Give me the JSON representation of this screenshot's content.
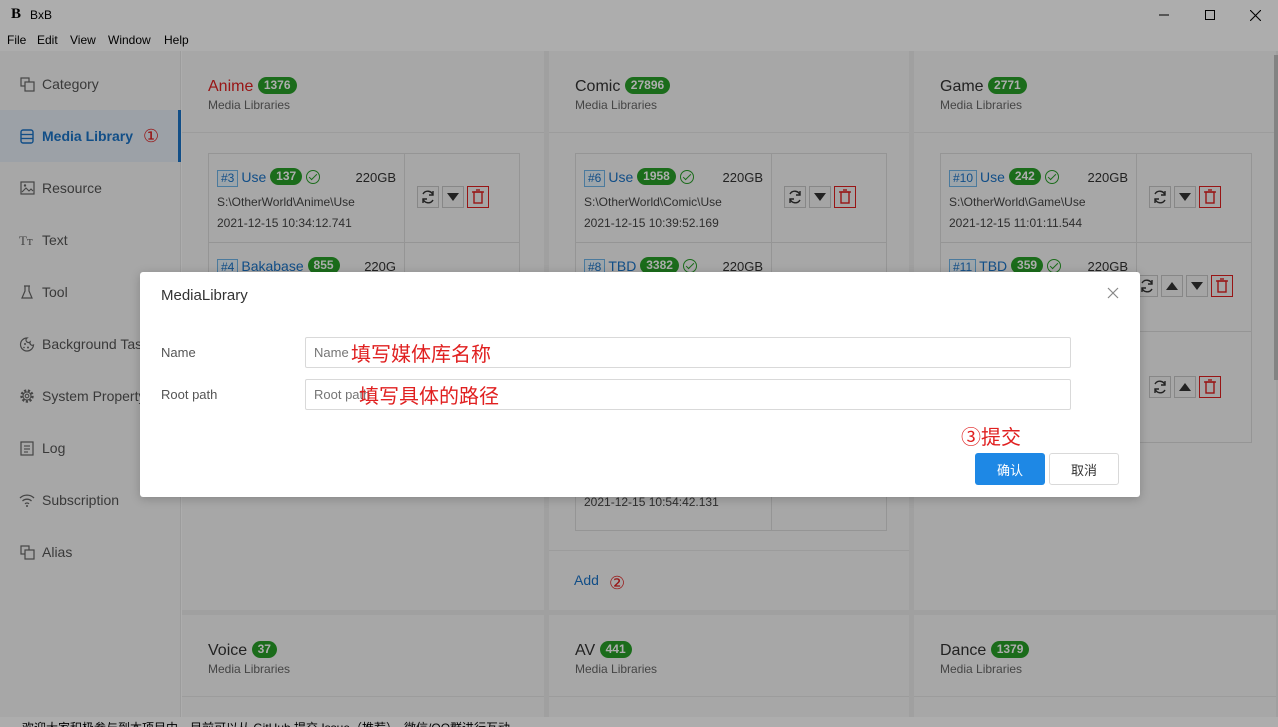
{
  "window": {
    "logo": "B",
    "title": "BxB"
  },
  "menu": [
    "File",
    "Edit",
    "View",
    "Window",
    "Help"
  ],
  "sidebar": {
    "items": [
      {
        "label": "Category",
        "icon": "category-icon"
      },
      {
        "label": "Media Library",
        "icon": "database-icon",
        "active": true,
        "annotation": "①"
      },
      {
        "label": "Resource",
        "icon": "image-icon"
      },
      {
        "label": "Text",
        "icon": "text-icon"
      },
      {
        "label": "Tool",
        "icon": "tool-icon"
      },
      {
        "label": "Background Tas",
        "icon": "cookie-icon"
      },
      {
        "label": "System Property",
        "icon": "gear-icon"
      },
      {
        "label": "Log",
        "icon": "log-icon"
      },
      {
        "label": "Subscription",
        "icon": "wifi-icon"
      },
      {
        "label": "Alias",
        "icon": "alias-icon"
      }
    ]
  },
  "panels": {
    "anime": {
      "title": "Anime",
      "count": "1376",
      "subtitle": "Media Libraries",
      "libs": [
        {
          "id": "#3",
          "name": "Use",
          "count": "137",
          "size": "220GB",
          "path": "S:\\OtherWorld\\Anime\\Use",
          "date": "2021-12-15 10:34:12.741"
        },
        {
          "id": "#4",
          "name": "Bakabase",
          "count": "855",
          "size": "220G"
        }
      ]
    },
    "comic": {
      "title": "Comic",
      "count": "27896",
      "subtitle": "Media Libraries",
      "libs": [
        {
          "id": "#6",
          "name": "Use",
          "count": "1958",
          "size": "220GB",
          "path": "S:\\OtherWorld\\Comic\\Use",
          "date": "2021-12-15 10:39:52.169"
        },
        {
          "id": "#8",
          "name": "TBD",
          "count": "3382",
          "size": "220GB"
        }
      ],
      "last_date": "2021-12-15 10:54:42.131",
      "add": "Add",
      "add_annotation": "②"
    },
    "game": {
      "title": "Game",
      "count": "2771",
      "subtitle": "Media Libraries",
      "libs": [
        {
          "id": "#10",
          "name": "Use",
          "count": "242",
          "size": "220GB",
          "path": "S:\\OtherWorld\\Game\\Use",
          "date": "2021-12-15 11:01:11.544"
        },
        {
          "id": "#11",
          "name": "TBD",
          "count": "359",
          "size": "220GB"
        }
      ]
    },
    "voice": {
      "title": "Voice",
      "count": "37",
      "subtitle": "Media Libraries"
    },
    "av": {
      "title": "AV",
      "count": "441",
      "subtitle": "Media Libraries"
    },
    "dance": {
      "title": "Dance",
      "count": "1379",
      "subtitle": "Media Libraries"
    }
  },
  "dialog": {
    "title": "MediaLibrary",
    "name_label": "Name",
    "name_placeholder": "Name",
    "name_annotation": "填写媒体库名称",
    "root_label": "Root path",
    "root_placeholder": "Root path",
    "root_annotation": "填写具体的路径",
    "submit_annotation": "③提交",
    "ok": "确认",
    "cancel": "取消"
  },
  "footer_text": "欢迎大家积极参与到本项目中，目前可以从 GitHub 提交 Issue（推荐）、微信/QQ群进行互动",
  "colors": {
    "accent": "#1a73c8",
    "badge": "#28a028",
    "danger": "#e02020",
    "primary_button": "#1e88e5"
  }
}
